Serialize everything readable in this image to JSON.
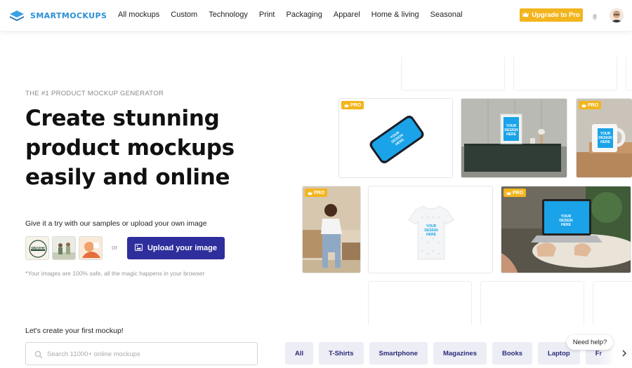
{
  "brand": {
    "name": "SMARTMOCKUPS",
    "color": "#2b8fd6"
  },
  "nav": {
    "items": [
      "All mockups",
      "Custom",
      "Technology",
      "Print",
      "Packaging",
      "Apparel",
      "Home & living",
      "Seasonal"
    ]
  },
  "header": {
    "upgrade_label": "Upgrade to Pro",
    "upgrade_color": "#f3b51d"
  },
  "hero": {
    "eyebrow": "THE #1 PRODUCT MOCKUP GENERATOR",
    "headline": "Create stunning product mockups easily and online",
    "try_text": "Give it a try with our samples or upload your own image",
    "or_text": "or",
    "upload_label": "Upload your image",
    "upload_color": "#2e2e9c",
    "safe_text": "*Your images are 100% safe, all the magic happens in your browser",
    "sample_badge_text": "RUNNER"
  },
  "search": {
    "heading": "Let's create your first mockup!",
    "placeholder": "Search 11000+ online mockups"
  },
  "categories": [
    "All",
    "T-Shirts",
    "Smartphone",
    "Magazines",
    "Books",
    "Laptop",
    "Fr"
  ],
  "mockups": {
    "pro_label": "PRO",
    "design_label": "YOUR DESIGN HERE"
  },
  "help": {
    "label": "Need help?"
  },
  "icons": {
    "logo": "layers-icon",
    "crown": "crown-icon",
    "bell": "bell-icon",
    "image": "image-icon",
    "search": "search-icon",
    "chevron": "chevron-right-icon"
  }
}
